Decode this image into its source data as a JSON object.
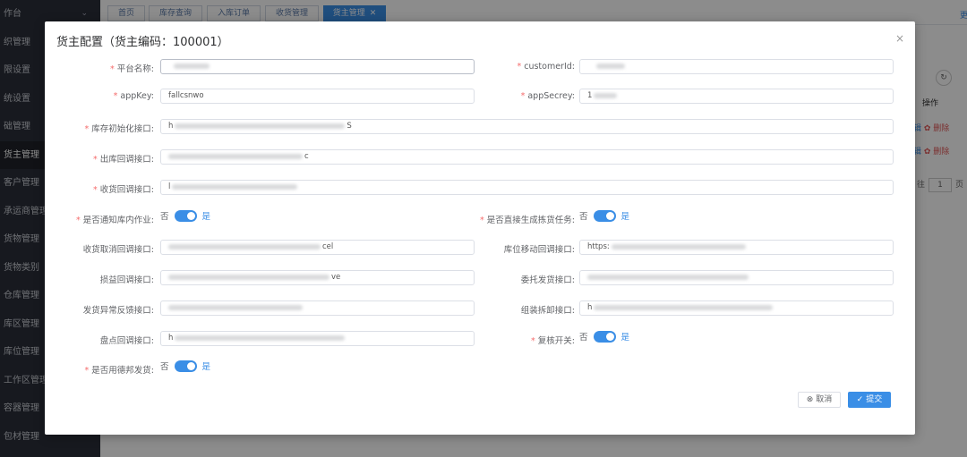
{
  "sidebar": {
    "items": [
      {
        "label": "作台"
      },
      {
        "label": "织管理"
      },
      {
        "label": "限设置"
      },
      {
        "label": "统设置"
      },
      {
        "label": "础管理"
      },
      {
        "label": "货主管理"
      },
      {
        "label": "客户管理"
      },
      {
        "label": "承运商管理"
      },
      {
        "label": "货物管理"
      },
      {
        "label": "货物类别"
      },
      {
        "label": "仓库管理"
      },
      {
        "label": "库区管理"
      },
      {
        "label": "库位管理"
      },
      {
        "label": "工作区管理"
      },
      {
        "label": "容器管理"
      },
      {
        "label": "包材管理"
      }
    ]
  },
  "tabs": [
    {
      "label": "首页"
    },
    {
      "label": "库存查询"
    },
    {
      "label": "入库订单"
    },
    {
      "label": "收货管理"
    },
    {
      "label": "货主管理",
      "close": "✕"
    }
  ],
  "background": {
    "column_header": "操作",
    "row_actions": [
      {
        "edit": "辑",
        "delete": "✿ 删除"
      },
      {
        "edit": "辑",
        "delete": "✿ 删除"
      }
    ],
    "pagination": {
      "before": "往",
      "page": "1",
      "after": "页"
    },
    "refresh": "↻",
    "top_link": "更"
  },
  "modal": {
    "title": "货主配置（货主编码：100001）",
    "close": "×",
    "fields": {
      "platform_name": {
        "label": "平台名称:",
        "required": "*"
      },
      "customer_id": {
        "label": "customerId:",
        "required": "*"
      },
      "app_key": {
        "label": "appKey:",
        "required": "*",
        "value": "fallcsnwo"
      },
      "app_secret": {
        "label": "appSecrey:",
        "required": "*",
        "value": "1"
      },
      "inventory_init": {
        "label": "库存初始化接口:",
        "required": "*",
        "value_start": "h",
        "value_end": "S"
      },
      "outbound_callback": {
        "label": "出库回调接口:",
        "required": "*",
        "value_end": "c"
      },
      "receive_callback": {
        "label": "收货回调接口:",
        "required": "*",
        "value_start": "l"
      },
      "receive_cancel_callback": {
        "label": "收货取消回调接口:",
        "value_end": "cel"
      },
      "location_move_callback": {
        "label": "库位移动回调接口:",
        "value_start": "https:"
      },
      "profit_loss_callback": {
        "label": "损益回调接口:",
        "value_end": "ve"
      },
      "consign_ship": {
        "label": "委托发货接口:"
      },
      "ship_exception": {
        "label": "发货异常反馈接口:"
      },
      "assembly": {
        "label": "组装拆卸接口:",
        "value_start": "h"
      },
      "stocktake_callback": {
        "label": "盘点回调接口:",
        "value_start": "h"
      }
    },
    "switches": {
      "notify_warehouse": {
        "label": "是否通知库内作业:",
        "required": "*",
        "off": "否",
        "on": "是"
      },
      "gen_picking": {
        "label": "是否直接生成拣货任务:",
        "required": "*",
        "off": "否",
        "on": "是"
      },
      "review": {
        "label": "复核开关:",
        "required": "*",
        "off": "否",
        "on": "是"
      },
      "debang": {
        "label": "是否用德邦发货:",
        "required": "*",
        "off": "否",
        "on": "是"
      }
    },
    "buttons": {
      "cancel": "⊗ 取消",
      "submit": "✓ 提交"
    }
  },
  "colors": {
    "primary": "#3a8ee6",
    "danger": "#f56c6c",
    "sidebar_bg": "#2b2f3a"
  }
}
